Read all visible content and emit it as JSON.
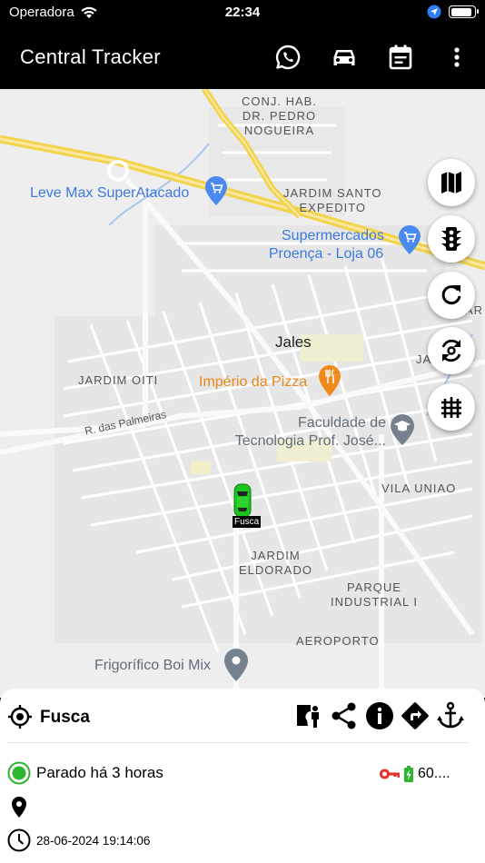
{
  "status_bar": {
    "carrier": "Operadora",
    "time": "22:34"
  },
  "app_bar": {
    "title": "Central Tracker",
    "icons": [
      "whatsapp-icon",
      "car-icon",
      "calendar-icon",
      "more-vert-icon"
    ]
  },
  "map": {
    "areas": {
      "conj_hab": "CONJ. HAB.",
      "dr_pedro": "DR. PEDRO",
      "nogueira": "NOGUEIRA",
      "jardim_santo": "JARDIM SANTO",
      "expedito": "EXPEDITO",
      "jardim_oiti": "JARDIM OITI",
      "vila_uniao": "VILA UNIAO",
      "jardim": "JARDIM",
      "eldorado": "ELDORADO",
      "parque": "PARQUE",
      "industrial": "INDUSTRIAL I",
      "aeroporto": "AEROPORTO",
      "ja_edge": "JA",
      "ar_edge": "AR"
    },
    "city": "Jales",
    "street": "R. das Palmeiras",
    "pois": {
      "leve_max": "Leve Max SuperAtacado",
      "super_1": "Supermercados",
      "super_2": "Proença - Loja 06",
      "imperio": "Império da Pizza",
      "faculdade_1": "Faculdade de",
      "faculdade_2": "Tecnologia Prof. José...",
      "frigorifico": "Frigorífico Boi Mix"
    },
    "vehicle_tag": "Fusca",
    "vehicle_color": "#1ec41e",
    "side_buttons": [
      "map-icon",
      "traffic-light-icon",
      "refresh-icon",
      "sync-icon",
      "grid-icon"
    ]
  },
  "sheet": {
    "vehicle_name": "Fusca",
    "status": "Parado há 3 horas",
    "status_color": "#2db52d",
    "ignition_color": "#e0312b",
    "battery_text": "60....",
    "address": "",
    "datetime": "28-06-2024 19:14:06",
    "actions": [
      "street-view-icon",
      "share-icon",
      "info-icon",
      "directions-icon",
      "anchor-icon"
    ]
  }
}
